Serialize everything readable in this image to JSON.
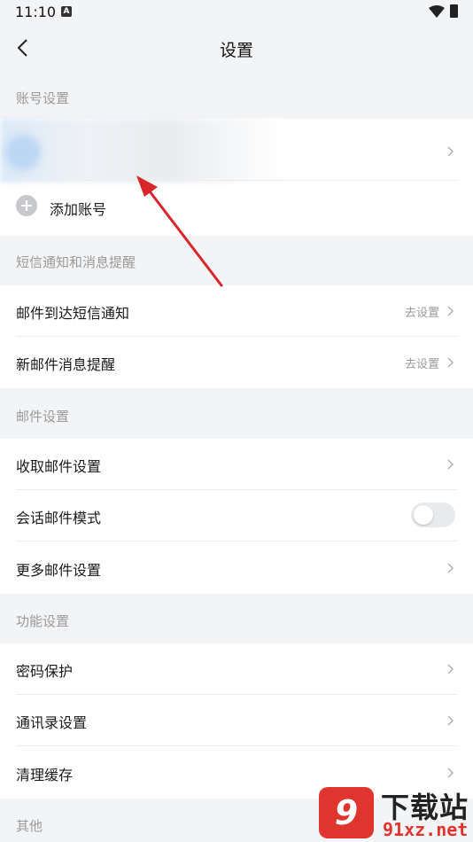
{
  "status_bar": {
    "time": "11:10",
    "notification_icon": "A"
  },
  "header": {
    "title": "设置"
  },
  "sections": {
    "account": {
      "label": "账号设置",
      "add_account": "添加账号"
    },
    "sms": {
      "label": "短信通知和消息提醒",
      "items": [
        {
          "label": "邮件到达短信通知",
          "hint": "去设置"
        },
        {
          "label": "新邮件消息提醒",
          "hint": "去设置"
        }
      ]
    },
    "mail": {
      "label": "邮件设置",
      "items": [
        {
          "label": "收取邮件设置"
        },
        {
          "label": "会话邮件模式",
          "toggle": false
        },
        {
          "label": "更多邮件设置"
        }
      ]
    },
    "function": {
      "label": "功能设置",
      "items": [
        {
          "label": "密码保护"
        },
        {
          "label": "通讯录设置"
        },
        {
          "label": "清理缓存"
        }
      ]
    },
    "other": {
      "label": "其他"
    }
  },
  "watermark": {
    "logo": "9",
    "name": "下载站",
    "url": "91xz.net"
  },
  "colors": {
    "annotation_arrow": "#d9262b",
    "background": "#f3f4f6",
    "card": "#ffffff"
  }
}
